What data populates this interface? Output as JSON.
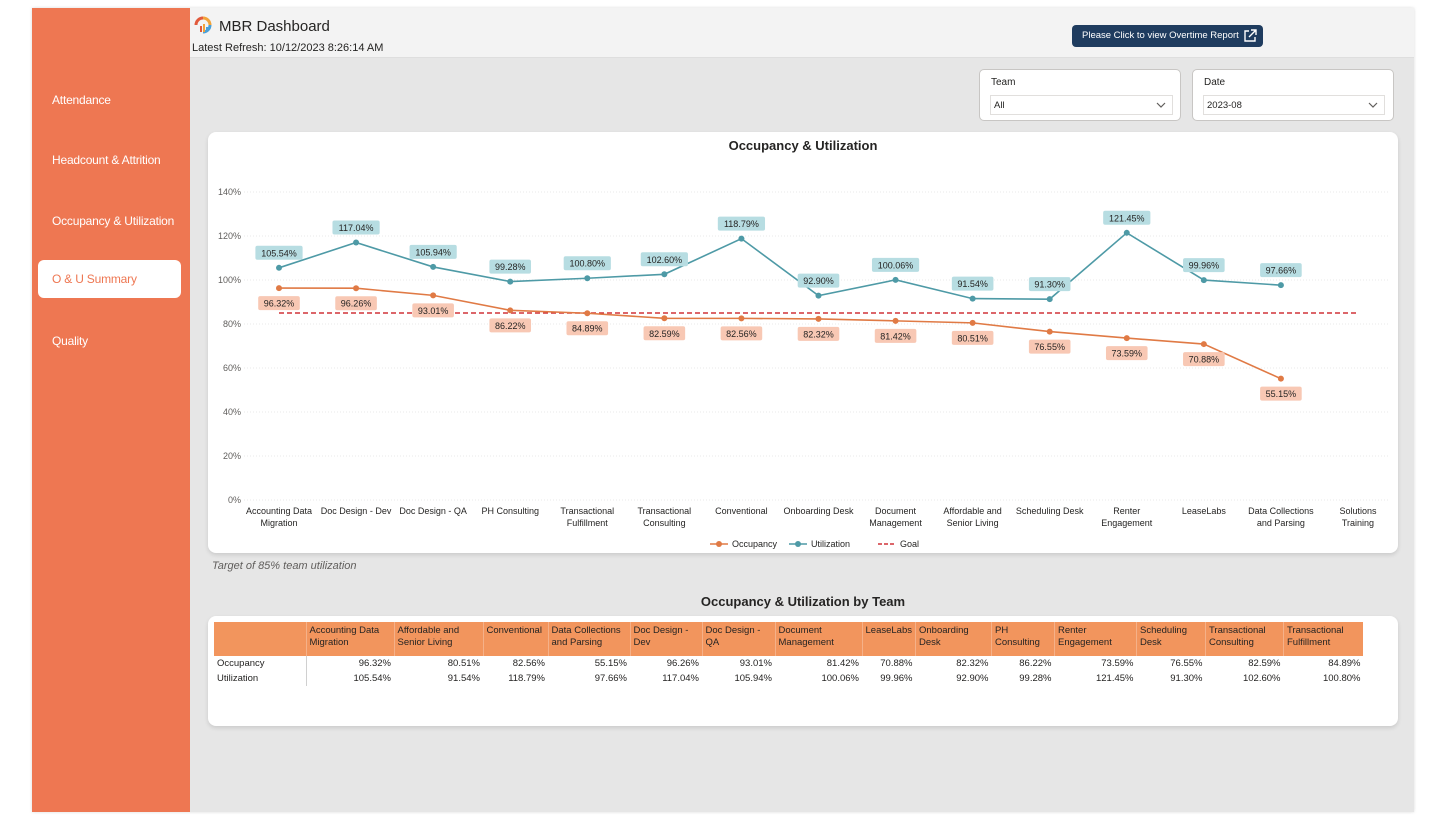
{
  "app": {
    "title": "MBR Dashboard",
    "refresh": "Latest Refresh: 10/12/2023 8:26:14 AM",
    "overtime_button": "Please Click to view Overtime Report"
  },
  "sidebar": {
    "items": [
      {
        "label": "Attendance"
      },
      {
        "label": "Headcount & Attrition"
      },
      {
        "label": "Occupancy & Utilization"
      },
      {
        "label": "O & U Summary"
      },
      {
        "label": "Quality"
      }
    ],
    "active_index": 3
  },
  "filters": {
    "team": {
      "label": "Team",
      "value": "All"
    },
    "date": {
      "label": "Date",
      "value": "2023-08"
    }
  },
  "chart_data": {
    "type": "line",
    "title": "Occupancy & Utilization",
    "categories": [
      "Accounting Data Migration",
      "Doc Design - Dev",
      "Doc Design - QA",
      "PH Consulting",
      "Transactional Fulfillment",
      "Transactional Consulting",
      "Conventional",
      "Onboarding Desk",
      "Document Management",
      "Affordable and Senior Living",
      "Scheduling Desk",
      "Renter Engagement",
      "LeaseLabs",
      "Data Collections and Parsing",
      "Solutions Training"
    ],
    "series": [
      {
        "name": "Occupancy",
        "color": "#e07a45",
        "label_bg": "#f8c8b4",
        "values": [
          96.32,
          96.26,
          93.01,
          86.22,
          84.89,
          82.59,
          82.56,
          82.32,
          81.42,
          80.51,
          76.55,
          73.59,
          70.88,
          55.15,
          null
        ],
        "labels": [
          "96.32%",
          "96.26%",
          "93.01%",
          "86.22%",
          "84.89%",
          "82.59%",
          "82.56%",
          "82.32%",
          "81.42%",
          "80.51%",
          "76.55%",
          "73.59%",
          "70.88%",
          "55.15%",
          ""
        ]
      },
      {
        "name": "Utilization",
        "color": "#4e9aa6",
        "label_bg": "#b7dde2",
        "values": [
          105.54,
          117.04,
          105.94,
          99.28,
          100.8,
          102.6,
          118.79,
          92.9,
          100.06,
          91.54,
          91.3,
          121.45,
          99.96,
          97.66,
          null
        ],
        "labels": [
          "105.54%",
          "117.04%",
          "105.94%",
          "99.28%",
          "100.80%",
          "102.60%",
          "118.79%",
          "92.90%",
          "100.06%",
          "91.54%",
          "91.30%",
          "121.45%",
          "99.96%",
          "97.66%",
          ""
        ]
      },
      {
        "name": "Goal",
        "color": "#d13438",
        "dashed": true,
        "values": [
          85,
          85,
          85,
          85,
          85,
          85,
          85,
          85,
          85,
          85,
          85,
          85,
          85,
          85,
          85
        ]
      }
    ],
    "y_ticks": [
      "0%",
      "20%",
      "40%",
      "60%",
      "80%",
      "100%",
      "120%",
      "140%"
    ],
    "ylim": [
      0,
      140
    ],
    "grid": true,
    "legend": "bottom-center"
  },
  "footnote": "Target of 85% team utilization",
  "table": {
    "title": "Occupancy & Utilization by Team",
    "columns": [
      "Accounting Data Migration",
      "Affordable and Senior Living",
      "Conventional",
      "Data Collections and Parsing",
      "Doc Design - Dev",
      "Doc Design - QA",
      "Document Management",
      "LeaseLabs",
      "Onboarding Desk",
      "PH Consulting",
      "Renter Engagement",
      "Scheduling Desk",
      "Transactional Consulting",
      "Transactional Fulfillment"
    ],
    "rows": [
      {
        "label": "Occupancy",
        "cells": [
          "96.32%",
          "80.51%",
          "82.56%",
          "55.15%",
          "96.26%",
          "93.01%",
          "81.42%",
          "70.88%",
          "82.32%",
          "86.22%",
          "73.59%",
          "76.55%",
          "82.59%",
          "84.89%"
        ]
      },
      {
        "label": "Utilization",
        "cells": [
          "105.54%",
          "91.54%",
          "118.79%",
          "97.66%",
          "117.04%",
          "105.94%",
          "100.06%",
          "99.96%",
          "92.90%",
          "99.28%",
          "121.45%",
          "91.30%",
          "102.60%",
          "100.80%"
        ]
      }
    ]
  }
}
